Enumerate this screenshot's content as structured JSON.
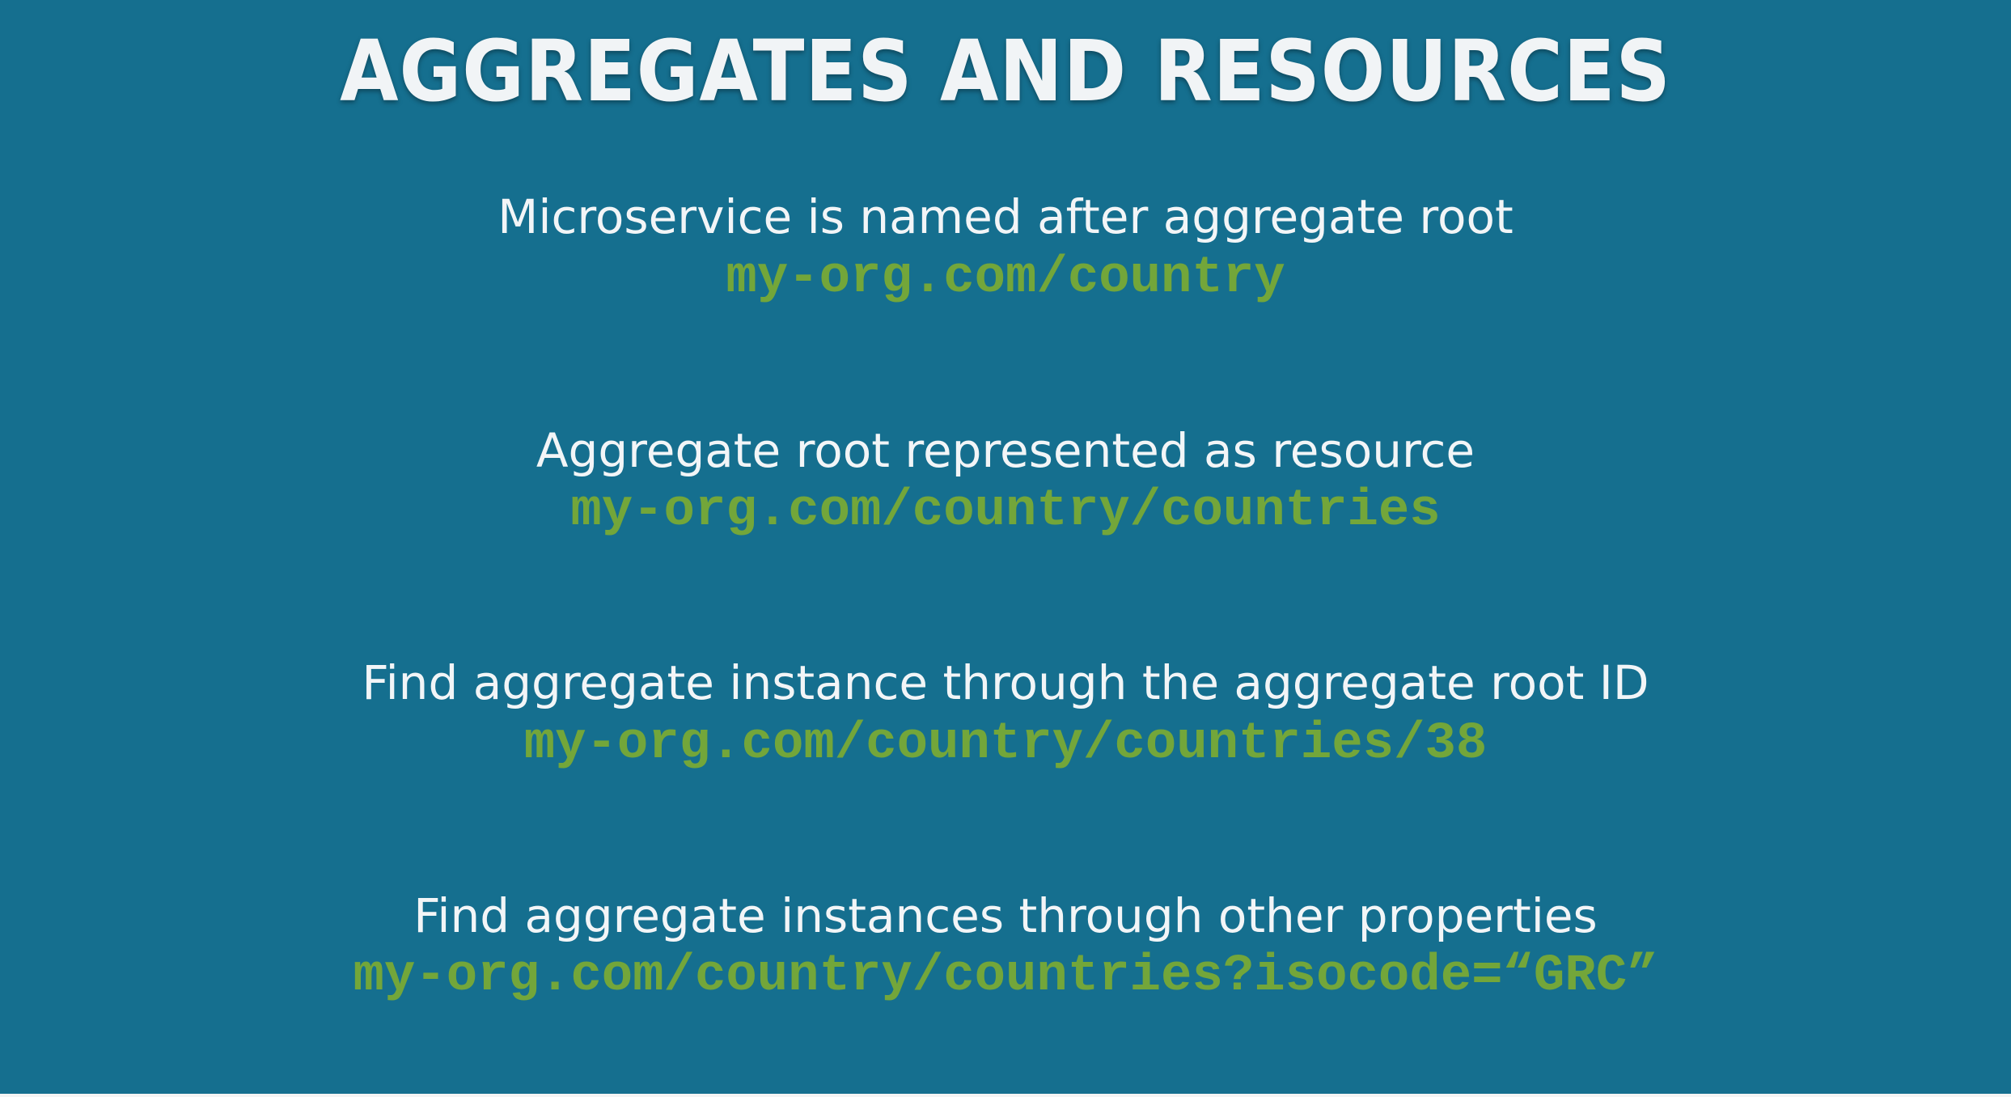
{
  "slide": {
    "title": "AGGREGATES AND RESOURCES",
    "items": [
      {
        "caption": "Microservice is named after aggregate root",
        "url": "my-org.com/country"
      },
      {
        "caption": "Aggregate root represented as resource",
        "url": "my-org.com/country/countries"
      },
      {
        "caption": "Find aggregate instance through the aggregate root ID",
        "url": "my-org.com/country/countries/38"
      },
      {
        "caption": "Find aggregate instances through other properties",
        "url": "my-org.com/country/countries?isocode=“GRC”"
      }
    ]
  },
  "colors": {
    "background": "#156f8f",
    "text": "#f2f5f7",
    "code": "#73a63a"
  }
}
